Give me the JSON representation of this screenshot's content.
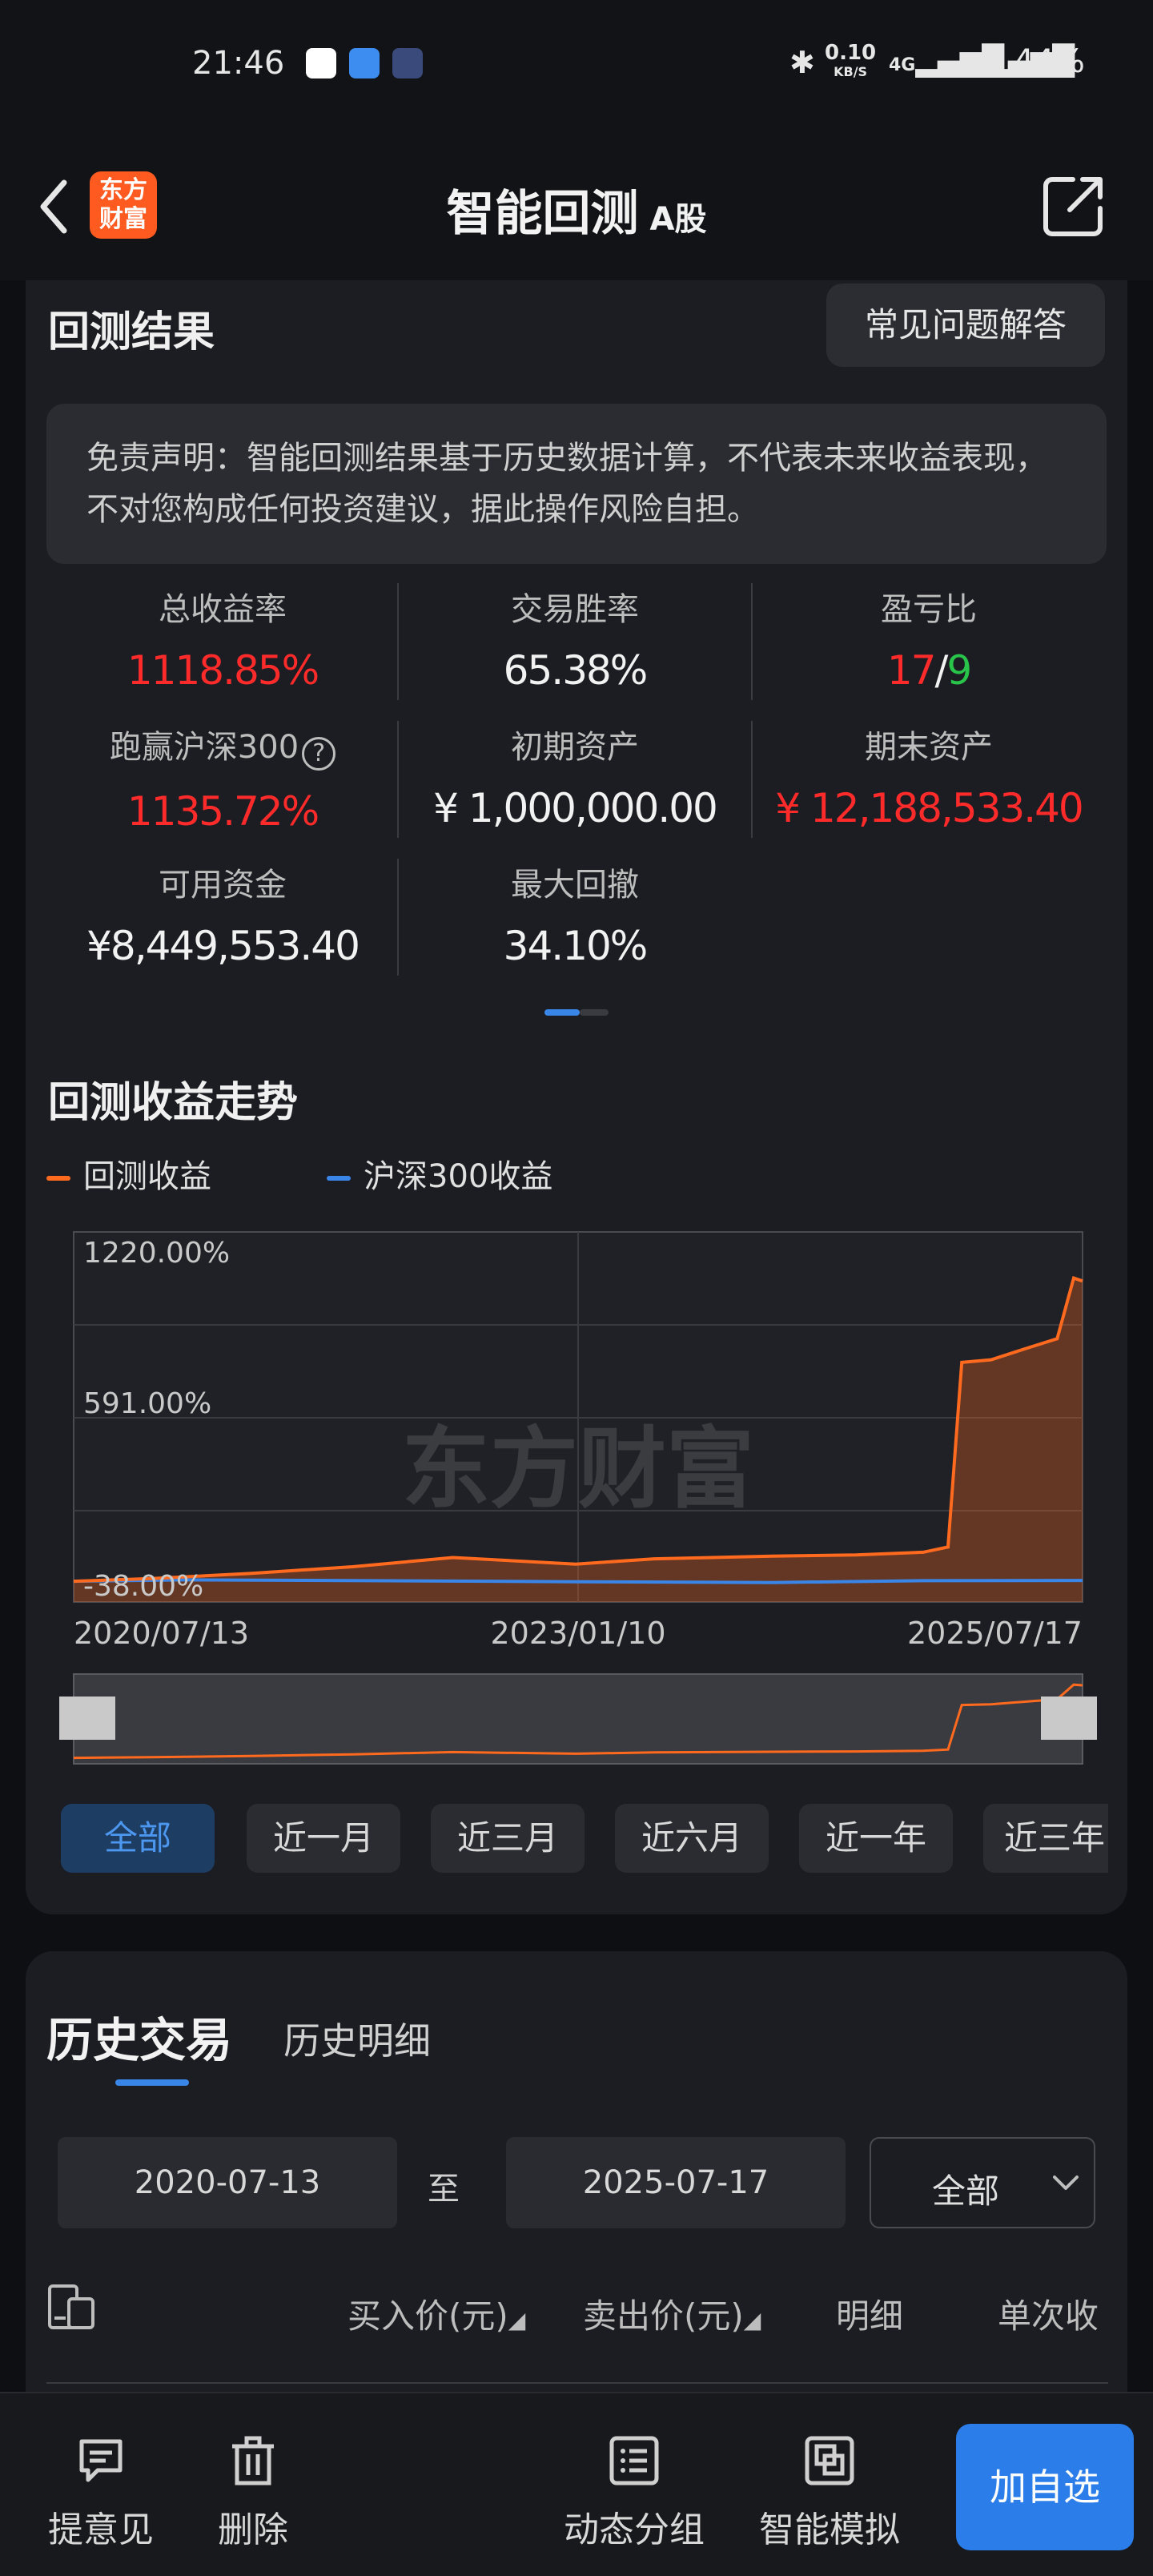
{
  "status_bar": {
    "time": "21:46",
    "speed": "0.10",
    "speed_unit": "KB/S",
    "network": "4G",
    "battery": "44%"
  },
  "nav": {
    "logo_text_1": "东方",
    "logo_text_2": "财富",
    "title": "智能回测",
    "subtitle": "A股"
  },
  "results": {
    "title": "回测结果",
    "faq_label": "常见问题解答",
    "disclaimer": "免责声明：智能回测结果基于历史数据计算，不代表未来收益表现，不对您构成任何投资建议，据此操作风险自担。",
    "metrics": {
      "total_return": {
        "label": "总收益率",
        "value": "1118.85%"
      },
      "win_rate": {
        "label": "交易胜率",
        "value": "65.38%"
      },
      "profit_loss": {
        "label": "盈亏比",
        "wins": "17",
        "sep": "/",
        "losses": "9"
      },
      "beat_index": {
        "label": "跑赢沪深300",
        "value": "1135.72%"
      },
      "initial_assets": {
        "label": "初期资产",
        "value": "¥ 1,000,000.00"
      },
      "final_assets": {
        "label": "期末资产",
        "value": "¥ 12,188,533.40"
      },
      "available_funds": {
        "label": "可用资金",
        "value": "¥8,449,553.40"
      },
      "max_drawdown": {
        "label": "最大回撤",
        "value": "34.10%"
      }
    }
  },
  "trend": {
    "title": "回测收益走势",
    "legend": [
      {
        "name": "回测收益",
        "color": "#ff6a1f"
      },
      {
        "name": "沪深300收益",
        "color": "#3a86e8"
      }
    ],
    "watermark": "东方财富",
    "range_buttons": [
      "全部",
      "近一月",
      "近三月",
      "近六月",
      "近一年",
      "近三年"
    ],
    "active_range": "全部"
  },
  "chart_data": {
    "type": "line",
    "y_tick_labels": [
      "1220.00%",
      "591.00%",
      "-38.00%"
    ],
    "ylim": [
      -38,
      1220
    ],
    "x_tick_labels": [
      "2020/07/13",
      "2023/01/10",
      "2025/07/17"
    ],
    "grid": true,
    "legend_position": "top-left",
    "series": [
      {
        "name": "回测收益",
        "color": "#ff6a1f",
        "x": [
          "2020/07/13",
          "2020/12/01",
          "2021/06/01",
          "2021/12/01",
          "2022/06/01",
          "2023/01/10",
          "2023/06/01",
          "2024/01/01",
          "2024/06/01",
          "2024/10/01",
          "2024/11/15",
          "2024/12/10",
          "2025/02/01",
          "2025/04/01",
          "2025/06/01",
          "2025/07/01",
          "2025/07/17"
        ],
        "values": [
          -20,
          -10,
          10,
          35,
          70,
          45,
          65,
          75,
          80,
          90,
          110,
          810,
          820,
          860,
          900,
          1130,
          1118.85
        ]
      },
      {
        "name": "沪深300收益",
        "color": "#3a86e8",
        "x": [
          "2020/07/13",
          "2021/02/01",
          "2022/01/01",
          "2023/01/10",
          "2024/01/01",
          "2024/10/01",
          "2025/07/17"
        ],
        "values": [
          -20,
          -15,
          -18,
          -22,
          -25,
          -18,
          -17
        ]
      }
    ]
  },
  "history": {
    "tab_active": "历史交易",
    "tab_other": "历史明细",
    "start_date": "2020-07-13",
    "to_label": "至",
    "end_date": "2025-07-17",
    "filter_value": "全部",
    "columns": [
      "买入价(元)",
      "卖出价(元)",
      "明细",
      "单次收"
    ]
  },
  "toolbar": {
    "feedback": "提意见",
    "delete": "删除",
    "group": "动态分组",
    "simulate": "智能模拟",
    "add_watch": "加自选"
  }
}
